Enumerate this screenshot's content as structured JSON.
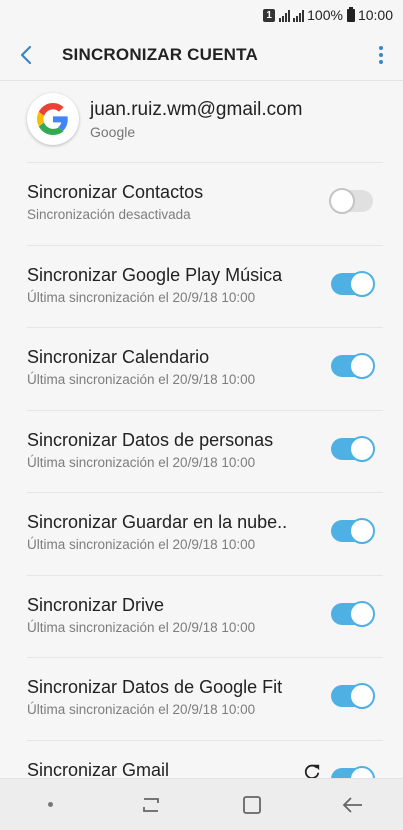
{
  "status_bar": {
    "sim_label": "1",
    "battery_percent": "100%",
    "time": "10:00"
  },
  "header": {
    "title": "SINCRONIZAR CUENTA",
    "back_icon": "chevron-left-icon",
    "more_icon": "more-vertical-icon",
    "accent_color": "#3a86c8"
  },
  "account": {
    "email": "juan.ruiz.wm@gmail.com",
    "type": "Google",
    "icon": "google-logo-icon"
  },
  "sync_items": [
    {
      "title": "Sincronizar Contactos",
      "subtitle": "Sincronización desactivada",
      "enabled": false
    },
    {
      "title": "Sincronizar Google Play Música",
      "subtitle": "Última sincronización el 20/9/18  10:00",
      "enabled": true
    },
    {
      "title": "Sincronizar Calendario",
      "subtitle": "Última sincronización el 20/9/18  10:00",
      "enabled": true
    },
    {
      "title": "Sincronizar Datos de personas",
      "subtitle": "Última sincronización el 20/9/18  10:00",
      "enabled": true
    },
    {
      "title": "Sincronizar Guardar en la nube..",
      "subtitle": "Última sincronización el 20/9/18  10:00",
      "enabled": true
    },
    {
      "title": "Sincronizar Drive",
      "subtitle": "Última sincronización el 20/9/18  10:00",
      "enabled": true
    },
    {
      "title": "Sincronizar Datos de Google Fit",
      "subtitle": "Última sincronización el 20/9/18  10:00",
      "enabled": true
    },
    {
      "title": "Sincronizar Gmail",
      "subtitle": "",
      "enabled": true,
      "syncing": true
    }
  ],
  "toggle_colors": {
    "on": "#4fb0e3",
    "off": "#e0e0e0"
  },
  "nav_bar": {
    "items": [
      "dot-icon",
      "recent-apps-icon",
      "home-icon",
      "back-icon"
    ]
  }
}
